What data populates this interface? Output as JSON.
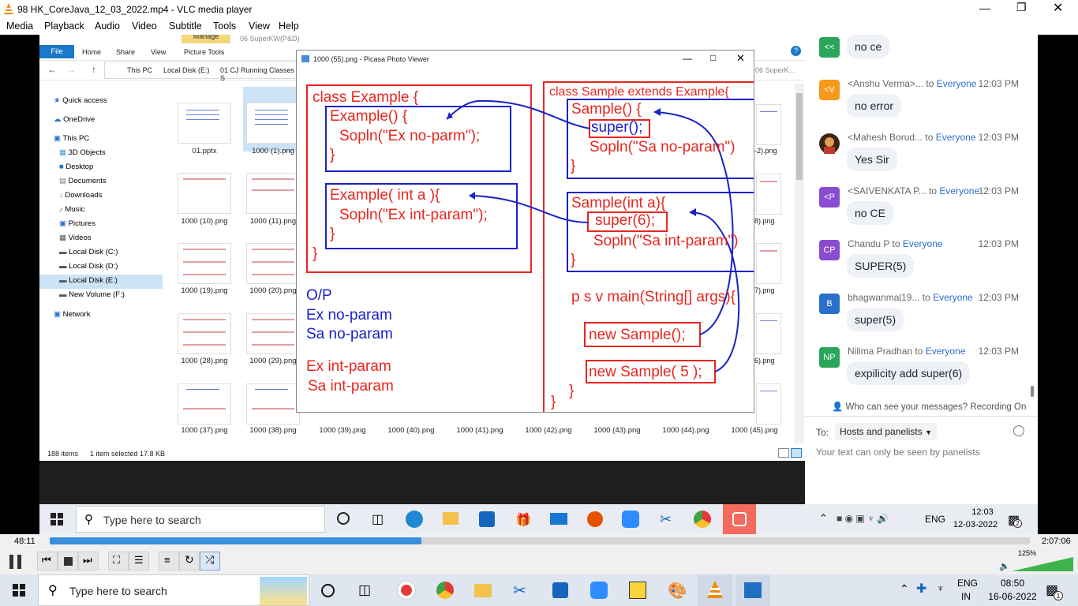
{
  "window": {
    "title": "98 HK_CoreJava_12_03_2022.mp4 - VLC media player"
  },
  "menu": [
    "Media",
    "Playback",
    "Audio",
    "Video",
    "Subtitle",
    "Tools",
    "View",
    "Help"
  ],
  "explorer": {
    "ribbon_tabs": [
      "File",
      "Home",
      "Share",
      "View",
      "Picture Tools"
    ],
    "manage_label": "Manage",
    "title": "06 SuperKW(P&D)",
    "breadcrumb": [
      "This PC",
      "Local Disk (E:)",
      "01 CJ Running Classes S"
    ],
    "search_placeholder": "06 SuperK...",
    "nav": [
      "Quick access",
      "OneDrive",
      "This PC",
      "3D Objects",
      "Desktop",
      "Documents",
      "Downloads",
      "Music",
      "Pictures",
      "Videos",
      "Local Disk (C:)",
      "Local Disk (D:)",
      "Local Disk (E:)",
      "New Volume (F:)",
      "Network"
    ],
    "files_row1": [
      "01.pptx",
      "1000 (1).png"
    ],
    "files_row2": [
      "1000 (10).png",
      "1000 (11).png"
    ],
    "files_row3": [
      "1000 (19).png",
      "1000 (20).png"
    ],
    "files_row4": [
      "1000 (28).png",
      "1000 (29).png"
    ],
    "files_bottom": [
      "1000 (37).png",
      "1000 (38).png",
      "1000 (39).png",
      "1000 (40).png",
      "1000 (41).png",
      "1000 (42).png",
      "1000 (43).png",
      "1000 (44).png",
      "1000 (45).png"
    ],
    "right_partial": [
      "-2).png",
      "8).png",
      "7).png",
      "6).png"
    ],
    "status": {
      "items": "188 items",
      "selected": "1 item selected  17.8 KB"
    }
  },
  "picasa": {
    "title": "1000 (55).png - Picasa Photo Viewer",
    "left_code": {
      "line1": "class Example {",
      "ctor1_line1": "Example() {",
      "ctor1_line2": "Sopln(\"Ex no-parm\");",
      "ctor1_line3": "}",
      "ctor2_line1": "Example( int a ){",
      "ctor2_line2": "Sopln(\"Ex int-param\");",
      "ctor2_line3": "}",
      "close": "}"
    },
    "output": {
      "label": "O/P",
      "lines_blue": [
        "Ex no-param",
        "Sa no-param"
      ],
      "lines_red": [
        "Ex int-param",
        "Sa int-param"
      ]
    },
    "right_code": {
      "line1": "class Sample extends Example{",
      "ctor1_line1": "Sample() {",
      "ctor1_super": "super();",
      "ctor1_line3": "Sopln(\"Sa no-param\")",
      "ctor1_close": "}",
      "ctor2_line1": "Sample(int a){",
      "ctor2_super": "super(6);",
      "ctor2_line3": "Sopln(\"Sa int-param\")",
      "ctor2_close": "}",
      "main": "p s v main(String[] args){",
      "new1": "new Sample();",
      "new2": "new Sample( 5 );",
      "close1": "}",
      "close2": "}"
    }
  },
  "chat": {
    "messages": [
      {
        "initials": "<<",
        "color": "#2aa65c",
        "sender": "",
        "to": "",
        "time": "",
        "text": "no ce"
      },
      {
        "initials": "<V",
        "color": "#f59a1b",
        "sender": "<Anshu Verma>...",
        "to": "Everyone",
        "time": "12:03 PM",
        "text": "no error"
      },
      {
        "initials": "",
        "color": "#5a3a20",
        "sender": "<Mahesh Borud...",
        "to": "Everyone",
        "time": "12:03 PM",
        "text": "Yes Sir"
      },
      {
        "initials": "<P",
        "color": "#8a4ccf",
        "sender": "<SAIVENKATA P...",
        "to": "Everyone",
        "time": "12:03 PM",
        "text": "no CE"
      },
      {
        "initials": "CP",
        "color": "#8a4ccf",
        "sender": "Chandu P",
        "to": "Everyone",
        "time": "12:03 PM",
        "text": "SUPER(5)"
      },
      {
        "initials": "B",
        "color": "#2a6fc9",
        "sender": "bhagwanmal19...",
        "to": "Everyone",
        "time": "12:03 PM",
        "text": "super(5)"
      },
      {
        "initials": "NP",
        "color": "#2aa65c",
        "sender": "Nilima Pradhan",
        "to": "Everyone",
        "time": "12:03 PM",
        "text": "expilicity add super(6)"
      }
    ],
    "to_word": "to",
    "notice": "Who can see your messages? Recording On",
    "to_label": "To:",
    "to_value": "Hosts and panelists",
    "input_placeholder": "Your text can only be seen by panelists"
  },
  "inner_taskbar": {
    "search_placeholder": "Type here to search",
    "lang": "ENG",
    "time": "12:03",
    "date": "12-03-2022",
    "notif_count": "2"
  },
  "vlc": {
    "elapsed": "48:11",
    "total": "2:07:06",
    "progress": 0.379,
    "volume_label": "125%",
    "volume": 1.0
  },
  "taskbar": {
    "search_placeholder": "Type here to search",
    "lang_line1": "ENG",
    "lang_line2": "IN",
    "time": "08:50",
    "date": "16-06-2022",
    "notif_count": "1"
  }
}
